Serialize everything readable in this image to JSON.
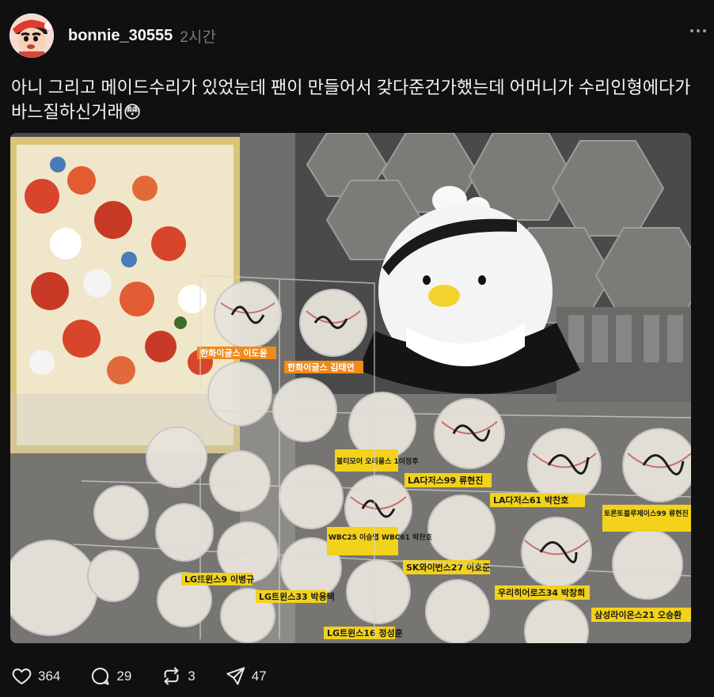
{
  "post": {
    "username": "bonnie_30555",
    "time": "2시간",
    "text": "아니 그리고 메이드수리가 있었눈데 팬이 만들어서 갖다준건가했는데 어머니가 수리인형에다가 바느질하신거래😳"
  },
  "photo_labels": {
    "l1": "한화이글스 이도윤",
    "l2": "한화이글스 김태연",
    "l3": "볼티모어 오리올스 1이정후",
    "l4": "LA다저스99 류현진",
    "l5": "LA다저스61 박찬호",
    "l6": "토론토블루제이스99 류현진",
    "l7": "WBC25 이승엽 WBC61 박찬호",
    "l8": "SK와이번스27 이호준",
    "l9": "우리히어로즈34 박창희",
    "l10": "삼성라이온스21 오승환",
    "l11": "LG트윈스9 이병규",
    "l12": "LG트윈스33 박용택",
    "l13": "LG트윈스16 정성훈"
  },
  "actions": {
    "likes": "364",
    "comments": "29",
    "reposts": "3",
    "shares": "47"
  },
  "colors": {
    "background": "#101010",
    "text": "#f3f5f7",
    "muted": "#7a7a7a",
    "label_orange": "#f08a1c",
    "label_yellow": "#f2d21b"
  }
}
